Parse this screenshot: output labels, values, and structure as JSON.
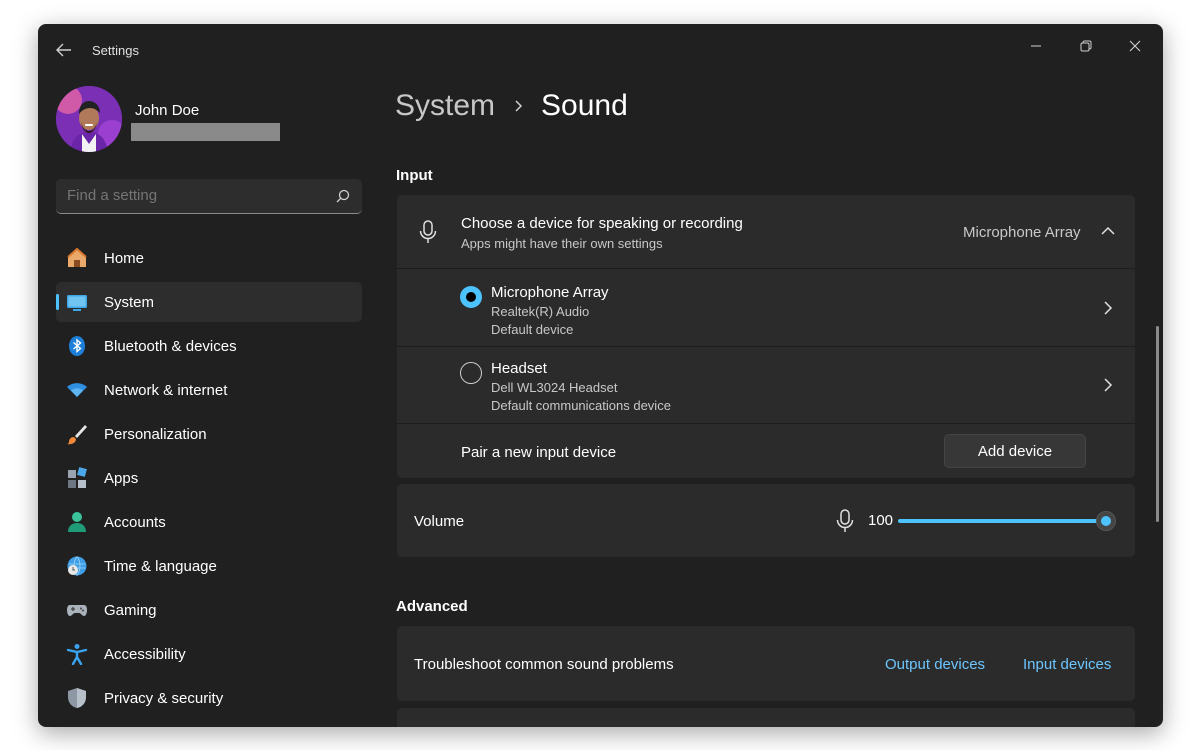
{
  "window": {
    "title": "Settings"
  },
  "profile": {
    "name": "John Doe"
  },
  "search": {
    "placeholder": "Find a setting"
  },
  "nav": {
    "items": [
      {
        "label": "Home",
        "icon": "home-icon"
      },
      {
        "label": "System",
        "icon": "system-icon",
        "active": true
      },
      {
        "label": "Bluetooth & devices",
        "icon": "bluetooth-icon"
      },
      {
        "label": "Network & internet",
        "icon": "wifi-icon"
      },
      {
        "label": "Personalization",
        "icon": "brush-icon"
      },
      {
        "label": "Apps",
        "icon": "apps-icon"
      },
      {
        "label": "Accounts",
        "icon": "person-icon"
      },
      {
        "label": "Time & language",
        "icon": "globe-clock-icon"
      },
      {
        "label": "Gaming",
        "icon": "controller-icon"
      },
      {
        "label": "Accessibility",
        "icon": "accessibility-icon"
      },
      {
        "label": "Privacy & security",
        "icon": "shield-icon"
      }
    ]
  },
  "breadcrumb": {
    "parent": "System",
    "current": "Sound"
  },
  "input": {
    "section_title": "Input",
    "chooser": {
      "title": "Choose a device for speaking or recording",
      "subtitle": "Apps might have their own settings",
      "selected": "Microphone Array"
    },
    "devices": [
      {
        "name": "Microphone Array",
        "driver": "Realtek(R) Audio",
        "role": "Default device",
        "selected": true
      },
      {
        "name": "Headset",
        "driver": "Dell WL3024 Headset",
        "role": "Default communications device",
        "selected": false
      }
    ],
    "pair": {
      "label": "Pair a new input device",
      "button": "Add device"
    },
    "volume": {
      "label": "Volume",
      "value": "100",
      "level": 100
    }
  },
  "advanced": {
    "section_title": "Advanced",
    "troubleshoot": {
      "label": "Troubleshoot common sound problems",
      "links": [
        "Output devices",
        "Input devices"
      ]
    }
  },
  "colors": {
    "accent": "#4cc2ff",
    "window_bg": "#202020",
    "card_bg": "#2b2b2b"
  }
}
